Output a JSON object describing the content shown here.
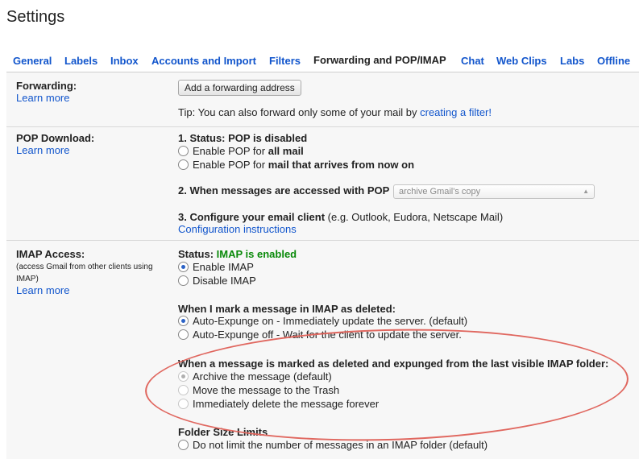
{
  "page": {
    "title": "Settings"
  },
  "tabs": [
    {
      "label": "General"
    },
    {
      "label": "Labels"
    },
    {
      "label": "Inbox"
    },
    {
      "label": "Accounts and Import"
    },
    {
      "label": "Filters"
    },
    {
      "label": "Forwarding and POP/IMAP",
      "active": true
    },
    {
      "label": "Chat"
    },
    {
      "label": "Web Clips"
    },
    {
      "label": "Labs"
    },
    {
      "label": "Offline"
    }
  ],
  "forwarding": {
    "label": "Forwarding:",
    "learn_more": "Learn more",
    "add_button": "Add a forwarding address",
    "tip_prefix": "Tip: You can also forward only some of your mail by ",
    "tip_link": "creating a filter!"
  },
  "pop": {
    "label": "POP Download:",
    "learn_more": "Learn more",
    "status_heading": "1. Status: POP is disabled",
    "option_all_prefix": "Enable POP for ",
    "option_all_bold": "all mail",
    "option_now_prefix": "Enable POP for ",
    "option_now_bold": "mail that arrives from now on",
    "accessed_heading": "2. When messages are accessed with POP",
    "accessed_select": "archive Gmail's copy",
    "configure_heading": "3. Configure your email client",
    "configure_note": " (e.g. Outlook, Eudora, Netscape Mail)",
    "configure_link": "Configuration instructions"
  },
  "imap": {
    "label": "IMAP Access:",
    "note": "(access Gmail from other clients using IMAP)",
    "learn_more": "Learn more",
    "status_prefix": "Status: ",
    "status_value": "IMAP is enabled",
    "enable": "Enable IMAP",
    "disable": "Disable IMAP",
    "deleted_heading": "When I mark a message in IMAP as deleted:",
    "expunge_on": "Auto-Expunge on - Immediately update the server. (default)",
    "expunge_off": "Auto-Expunge off - Wait for the client to update the server.",
    "expunged_heading": "When a message is marked as deleted and expunged from the last visible IMAP folder:",
    "archive": "Archive the message (default)",
    "trash": "Move the message to the Trash",
    "delete_forever": "Immediately delete the message forever",
    "folder_heading": "Folder Size Limits",
    "no_limit": "Do not limit the number of messages in an IMAP folder (default)"
  },
  "annotation": {
    "color": "#e0675f"
  },
  "colors": {
    "link": "#1155cc",
    "enabled": "#0a8a0a",
    "panel": "#f7f7f7"
  }
}
